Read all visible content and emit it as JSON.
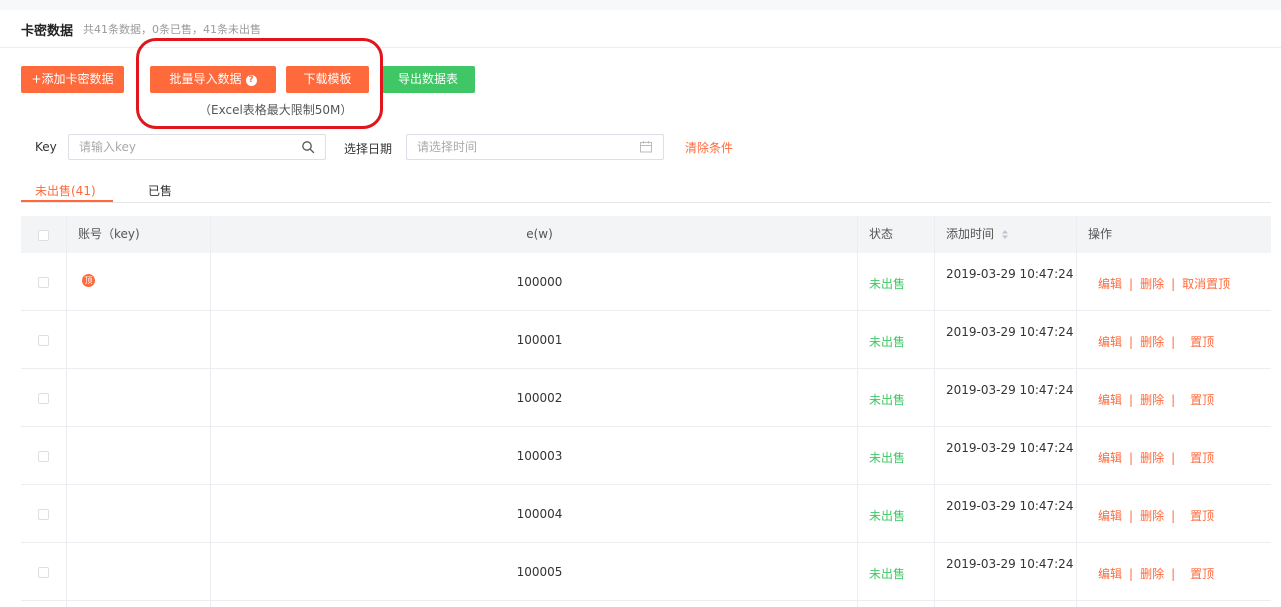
{
  "header": {
    "title": "卡密数据",
    "summary": "共41条数据，0条已售，41条未出售"
  },
  "toolbar": {
    "add_label": "+添加卡密数据",
    "import_label": "批量导入数据",
    "help_symbol": "?",
    "download_label": "下载模板",
    "export_label": "导出数据表",
    "limit_note": "（Excel表格最大限制50M）"
  },
  "filters": {
    "key_label": "Key",
    "key_placeholder": "请输入key",
    "date_label": "选择日期",
    "date_placeholder": "请选择时间",
    "clear_label": "清除条件"
  },
  "tabs": [
    {
      "label": "未出售(41)",
      "active": true
    },
    {
      "label": "已售",
      "active": false
    }
  ],
  "table": {
    "columns": [
      "账号（key)",
      "e(w)",
      "状态",
      "添加时间",
      "操作"
    ],
    "rows": [
      {
        "pinned": true,
        "badge": "顶",
        "value": "100000",
        "status": "未出售",
        "time": "2019-03-29 10:47:24",
        "ops": [
          "编辑",
          "删除",
          "取消置顶"
        ]
      },
      {
        "pinned": false,
        "badge": "",
        "value": "100001",
        "status": "未出售",
        "time": "2019-03-29 10:47:24",
        "ops": [
          "编辑",
          "删除",
          "置顶"
        ]
      },
      {
        "pinned": false,
        "badge": "",
        "value": "100002",
        "status": "未出售",
        "time": "2019-03-29 10:47:24",
        "ops": [
          "编辑",
          "删除",
          "置顶"
        ]
      },
      {
        "pinned": false,
        "badge": "",
        "value": "100003",
        "status": "未出售",
        "time": "2019-03-29 10:47:24",
        "ops": [
          "编辑",
          "删除",
          "置顶"
        ]
      },
      {
        "pinned": false,
        "badge": "",
        "value": "100004",
        "status": "未出售",
        "time": "2019-03-29 10:47:24",
        "ops": [
          "编辑",
          "删除",
          "置顶"
        ]
      },
      {
        "pinned": false,
        "badge": "",
        "value": "100005",
        "status": "未出售",
        "time": "2019-03-29 10:47:24",
        "ops": [
          "编辑",
          "删除",
          "置顶"
        ]
      }
    ]
  },
  "colors": {
    "accent": "#ff6a3c",
    "success": "#3ec764",
    "highlight_frame": "#e0161c"
  },
  "icons": {
    "search": "search-icon",
    "calendar": "calendar-icon",
    "sort": "sort-icon",
    "help": "help-icon"
  }
}
